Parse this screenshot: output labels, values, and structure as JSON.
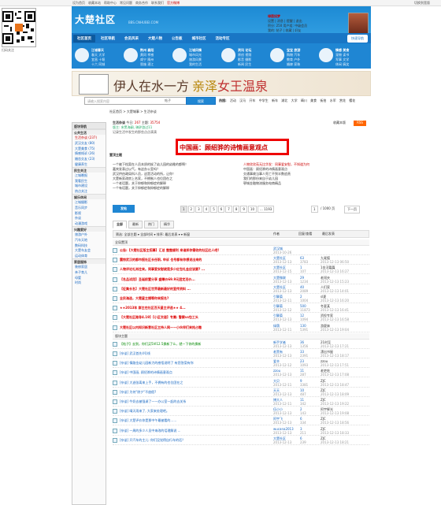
{
  "topbar": {
    "links": [
      "设为首页",
      "收藏本站",
      "帮助中心",
      "常见问题",
      "商务合作",
      "联系我们",
      "官方微博"
    ],
    "right": "切换到宽版"
  },
  "qr_label": "扫码关注",
  "header": {
    "logo": "大楚社区",
    "logo_sub": "BBS.CNHUBEI.COM",
    "user": {
      "name": "绿茵如梦",
      "line1": "设置 | 消息 | 提醒 | 退出",
      "line2": "积分: 250  用户组: 中级会员",
      "line3": "我的: 帖子 | 收藏 | 好友"
    },
    "nav": [
      "社区首页",
      "社区导航",
      "会员风采",
      "大楚人物",
      "公告板",
      "城市社区",
      "活动专区"
    ],
    "nav_active": "社区首页",
    "quick": "快速导航"
  },
  "subnav": [
    {
      "title": "江城春天",
      "links": [
        "春天 大学",
        "宜昌 十堰",
        "十六 同城"
      ]
    },
    {
      "title": "荆州 襄阳",
      "links": [
        "黄冈 孝感",
        "咸宁 随州",
        "恩施 潜江"
      ]
    },
    {
      "title": "江城风情",
      "links": [
        "城市风光",
        "旅游风景",
        "我的生活"
      ]
    },
    {
      "title": "资讯 论坛",
      "links": [
        "原创 视频",
        "影音 摄影",
        "新闻 民生"
      ]
    },
    {
      "title": "宝宝 旅游",
      "links": [
        "购物 汽车",
        "教育 户外",
        "婚嫁 家装"
      ]
    },
    {
      "title": "情感 美食",
      "links": [
        "宠物 读书",
        "军事 文学",
        "休闲 搞笑"
      ]
    }
  ],
  "banner": {
    "name1": "伊人在水一方",
    "name2a": "亲泽",
    "name2b": "女王温泉"
  },
  "search": {
    "placeholder": "请输入搜索内容",
    "type": "帖子",
    "button": "搜索",
    "hot_label": "热搜:",
    "hot": [
      "活动",
      "汉马",
      "开车",
      "中学生",
      "新车",
      "湖北",
      "大学",
      "晴川",
      "美食",
      "街拍",
      "水军",
      "赏花",
      "樱花"
    ]
  },
  "sidebar": {
    "header": "版块导航",
    "groups": [
      {
        "name": "公共生活",
        "items": [
          "生活杂谈 (237)",
          "武汉交友 (80)",
          "大楚美食 (75)",
          "情感倾诉 (26)",
          "婚恋交友 (23)",
          "健康养生"
        ]
      },
      {
        "name": "民生关注",
        "items": [
          "江城晚报",
          "我看民生",
          "城市建设",
          "热点关注"
        ]
      },
      {
        "name": "娱乐休闲",
        "items": [
          "江城摄影",
          "音乐同步",
          "影视",
          "杂谈",
          "动漫游戏"
        ]
      },
      {
        "name": "兴趣爱好",
        "items": [
          "旅游户外",
          "汽车天地",
          "数码科技",
          "大楚车友会",
          "运动体育"
        ]
      },
      {
        "name": "家居服饰",
        "items": [
          "装修家居",
          "亲子育儿",
          "母婴",
          "时尚"
        ]
      }
    ]
  },
  "forum": {
    "crumb": "社区首页  >  大楚城事  >  生活杂谈",
    "name": "生活杂谈",
    "today_label": "今日:",
    "today": "267",
    "topics_label": "主题:",
    "topics": "35754",
    "moderators": "版主: 宋黑海嗣, 骑驴游过11",
    "desc": "记录生活中发生的那些点点滴滴",
    "fav": "收藏本版",
    "rss": "RSS",
    "highlight": "中国画：顾绍骅的诗情画意观点",
    "top_header": "置顶主题",
    "left_topics": [
      "一个被下档案在人员本质的挨了幼儿园的幼稚的都啊！",
      "嘉宾发表过以气，有这办公室吗？",
      "武汉供由政局科人员，这是活动的所，让你！",
      "大楚新家改房上名家，不拥制人也位团在之",
      "一个老话题，关于抑郁和抑郁症的解释",
      "一个有话题，关于抑郁症和抑郁症的解释"
    ],
    "right_topics": [
      "人物欣欣苑无比华发：同事爱安慰，不知道为何",
      "中国画：顾绍骅的诗情画意观点",
      "交通事故当事人死亡不到半数追责",
      "我们的那份来自于幼儿园",
      "鄂城金融物流服务电商精品"
    ],
    "post_button": "发帖",
    "pages": [
      "1",
      "2",
      "3",
      "4",
      "5",
      "6",
      "7",
      "8",
      "9",
      "10",
      "... 1193"
    ],
    "page_cur": "1",
    "page_total": "/ 1000 页",
    "next": "下一页",
    "tabs": [
      "全部",
      "最新",
      "热门",
      "精华"
    ],
    "tab_active": "全部",
    "filter": "筛选: 全部主题 ▾ 全部时间 ▾ 排序: 最后发表 ▾  ▾ 新窗",
    "col_author": "作者",
    "col_reply": "回复/查看",
    "col_last": "最后发表",
    "sec_top": "全局置顶",
    "sec_normal": "版块主题",
    "rows": [
      {
        "title": "公告:【大楚社区版主招募】汇总 整整顺利 来谁邦你需收的社区红人吧!",
        "cls": "red",
        "author": "武汉城",
        "date": "2013-10-26",
        "reply": "",
        "view": "",
        "last": "",
        "lastd": ""
      },
      {
        "title": "震惊武汉的都市报社区长任职, 申诉 也号都有你想说出来的",
        "cls": "red",
        "author": "大楚社区",
        "date": "2013-12-13",
        "reply": "63",
        "view": "3783",
        "last": "九尾狐",
        "lastd": "2013-12-13 06:50"
      },
      {
        "title": "人物评论礼尚往来。同事爱安慰就是多少红包礼金应该要? ...",
        "cls": "red",
        "author": "大楚社区",
        "date": "2013-12-15",
        "reply": "1",
        "view": "107",
        "last": "1金河篇篇",
        "lastd": "2013-12-13 16:27"
      },
      {
        "title": "【名品试用】圣诞前置分享 盛赠价69.9元团定活价...",
        "cls": "red",
        "author": "大楚微联",
        "date": "2013-12-13",
        "reply": "29",
        "view": "1234",
        "last": "老闯夫",
        "lastd": "2013-12-13 15:23"
      },
      {
        "title": "【征集长名】大楚社区世界最新最好的宣传资料 ...",
        "cls": "red",
        "author": "大楚社区",
        "date": "2013-12-13",
        "reply": "40",
        "view": "2089",
        "last": "人们家",
        "lastd": "2013-12-13 14:01"
      },
      {
        "title": "全民海选，大楚星主播等你来报名?",
        "cls": "red",
        "author": "引擎菊",
        "date": "2013-12-11",
        "reply": "2",
        "view": "1004",
        "last": "sl夏",
        "lastd": "2013-12-13 16:20"
      },
      {
        "title": "★★2013年 群主在社区百天星主评选★★ 4...",
        "cls": "red",
        "author": "引擎菊",
        "date": "2013-12-12",
        "reply": "500",
        "view": "11873",
        "last": "冬夏某",
        "lastd": "2013-12-13 16:41"
      },
      {
        "title": "【大楚社区路导4.19】【小区交道】专属: 警察vs包工头",
        "cls": "red",
        "author": "引擎菊",
        "date": "2013-12-13",
        "reply": "12",
        "view": "1094",
        "last": "资投专家",
        "lastd": "2013-12-13 16:58"
      },
      {
        "title": "大楚社区以内知识新意社区主持人网——小伙伴们来抢占嗷",
        "cls": "red",
        "author": "绿荫",
        "date": "2013-12-11",
        "reply": "130",
        "view": "5391",
        "last": "游夏妹",
        "lastd": "2013-12-13 19:04"
      },
      {
        "title": "【帖子】去到，你们买5VI12.5换新了么，就一下你的换新",
        "cls": "grn",
        "author": "新手学者",
        "date": "2013-12-13",
        "reply": "36",
        "view": "1356",
        "last": "21时至",
        "lastd": "2013-12-13 17:21"
      },
      {
        "title": "[杂谈] 武汉首先4号线",
        "cls": "blu",
        "author": "老黑有",
        "date": "2013-12-13",
        "reply": "33",
        "view": "2391",
        "last": "漂出书屋",
        "lastd": "2013-12-13 18:17"
      },
      {
        "title": "[杂谈] 情路金幼儿园新力的感悟说明了 有您答案有你",
        "cls": "blu",
        "author": "爱辛",
        "date": "2013-12-12",
        "reply": "23",
        "view": "1093",
        "last": "zzou",
        "lastd": "2013-12-13 17:51"
      },
      {
        "title": "[杂谈] 中国画, 顾绍骅的诗情画意观点",
        "cls": "blu",
        "author": "zzou",
        "date": "2013-12-13",
        "reply": "11",
        "view": "287",
        "last": "老吏吃",
        "lastd": "2013-12-13 17:08"
      },
      {
        "title": "[杂谈] 大逃张离来上手，不拥有的也位团在之",
        "cls": "blu",
        "author": "大贝",
        "date": "2013-12-11",
        "reply": "9",
        "view": "3381",
        "last": "ZJC",
        "lastd": "2013-12-13 18:47"
      },
      {
        "title": "[杂谈] 为何\"除夕\"不放假?",
        "cls": "blu",
        "author": "天天",
        "date": "2013-12-13",
        "reply": "10",
        "view": "487",
        "last": "ZJC",
        "lastd": "2013-12-13 18:09"
      },
      {
        "title": "[杂谈] 牛奶去被强调了——办公室一起的去关系",
        "cls": "blu",
        "author": "博大人",
        "date": "2013-12-11",
        "reply": "11",
        "view": "342",
        "last": "ZJC",
        "lastd": "2013-12-13 19:22"
      },
      {
        "title": "[杂谈] 晴天雨来了, 大家来处理吧。",
        "cls": "blu",
        "author": "伍小小",
        "date": "2013-12-13",
        "reply": "2",
        "view": "143",
        "last": "阿宇辉光",
        "lastd": "2013-12-13 19:08"
      },
      {
        "title": "[杂谈] 大楚评价你是那中午最被看的……",
        "cls": "blu",
        "author": "阿宇飞",
        "date": "2013-12-13",
        "reply": "6",
        "view": "334",
        "last": "ZJC",
        "lastd": "2013-12-13 18:56"
      },
      {
        "title": "[杂谈] 一周的多少人员中来改的话理解说 ...",
        "cls": "blu",
        "author": "wucana2013",
        "date": "2013-12-13",
        "reply": "3",
        "view": "211",
        "last": "ZJC",
        "lastd": "2013-12-13 18:33"
      },
      {
        "title": "[杂谈] 开汽车的主儿: 你们没觉得自行车的话？",
        "cls": "blu",
        "author": "大楚社区",
        "date": "2013-12-13",
        "reply": "6",
        "view": "239",
        "last": "ZJC",
        "lastd": "2013-12-13 18:21"
      }
    ]
  }
}
